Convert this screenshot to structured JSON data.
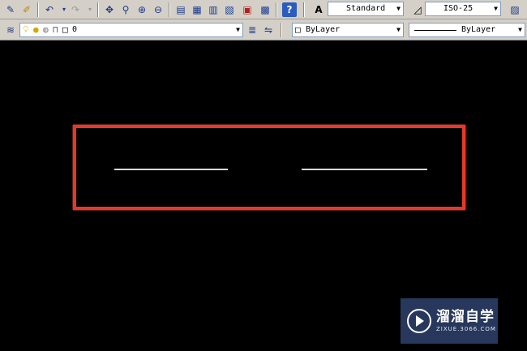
{
  "toolbar_top": {
    "text_style": "Standard",
    "dim_style": "ISO-25"
  },
  "toolbar_layers": {
    "layer_name": "0",
    "color": "ByLayer",
    "linetype": "ByLayer"
  },
  "watermark": {
    "brand_cn": "溜溜自学",
    "url": "ZIXUE.3066.COM"
  },
  "colors": {
    "canvas": "#000000",
    "highlight": "#e8372a",
    "lines": "#d8d8d8"
  }
}
